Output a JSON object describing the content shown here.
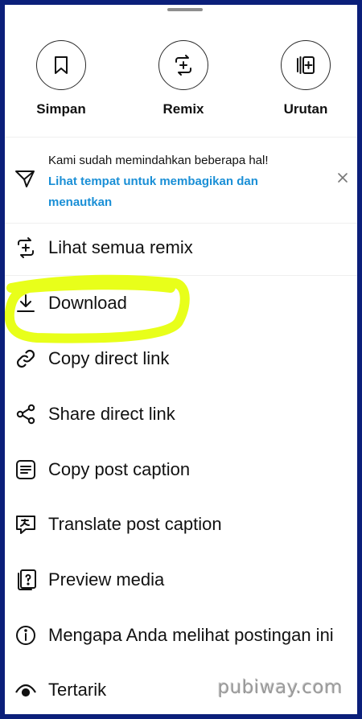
{
  "actions": [
    {
      "label": "Simpan",
      "icon": "bookmark-icon"
    },
    {
      "label": "Remix",
      "icon": "remix-icon"
    },
    {
      "label": "Urutan",
      "icon": "sequence-icon"
    }
  ],
  "notice": {
    "line1": "Kami sudah memindahkan beberapa hal!",
    "link": "Lihat tempat untuk membagikan dan menautkan"
  },
  "menu": [
    {
      "label": "Lihat semua remix",
      "icon": "remix-icon"
    },
    {
      "label": "Download",
      "icon": "download-icon"
    },
    {
      "label": "Copy direct link",
      "icon": "link-icon"
    },
    {
      "label": "Share direct link",
      "icon": "share-icon"
    },
    {
      "label": "Copy post caption",
      "icon": "caption-icon"
    },
    {
      "label": "Translate post caption",
      "icon": "translate-icon"
    },
    {
      "label": "Preview media",
      "icon": "preview-icon"
    },
    {
      "label": "Mengapa Anda melihat postingan ini",
      "icon": "info-icon"
    },
    {
      "label": "Tertarik",
      "icon": "eye-icon"
    }
  ],
  "watermark": "pubiway.com",
  "colors": {
    "link": "#1a8fd6",
    "highlight": "#e8ff1a",
    "frame": "#0b1f7a"
  }
}
